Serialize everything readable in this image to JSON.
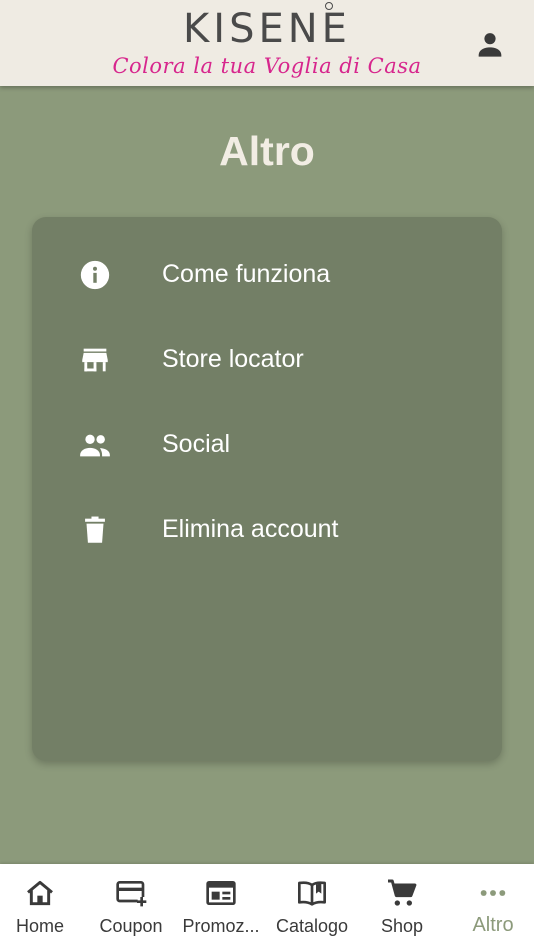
{
  "header": {
    "logo_word": "KISENE",
    "logo_tagline": "Colora la tua Voglia di Casa",
    "profile_icon": "person-icon"
  },
  "page": {
    "title": "Altro"
  },
  "menu": {
    "items": [
      {
        "label": "Come funziona",
        "icon": "info-icon"
      },
      {
        "label": "Store locator",
        "icon": "store-icon"
      },
      {
        "label": "Social",
        "icon": "people-icon"
      },
      {
        "label": "Elimina account",
        "icon": "trash-icon"
      }
    ]
  },
  "nav": {
    "items": [
      {
        "label": "Home",
        "icon": "home-icon"
      },
      {
        "label": "Coupon",
        "icon": "coupon-icon"
      },
      {
        "label": "Promoz...",
        "icon": "newspaper-icon"
      },
      {
        "label": "Catalogo",
        "icon": "book-icon"
      },
      {
        "label": "Shop",
        "icon": "cart-icon"
      },
      {
        "label": "Altro",
        "icon": "more-icon"
      }
    ],
    "active_index": 5
  },
  "colors": {
    "background": "#8c9a7b",
    "header_bg": "#efebe3",
    "card_bg": "#737f66",
    "accent": "#8c9a7b",
    "tagline": "#d7268d"
  }
}
